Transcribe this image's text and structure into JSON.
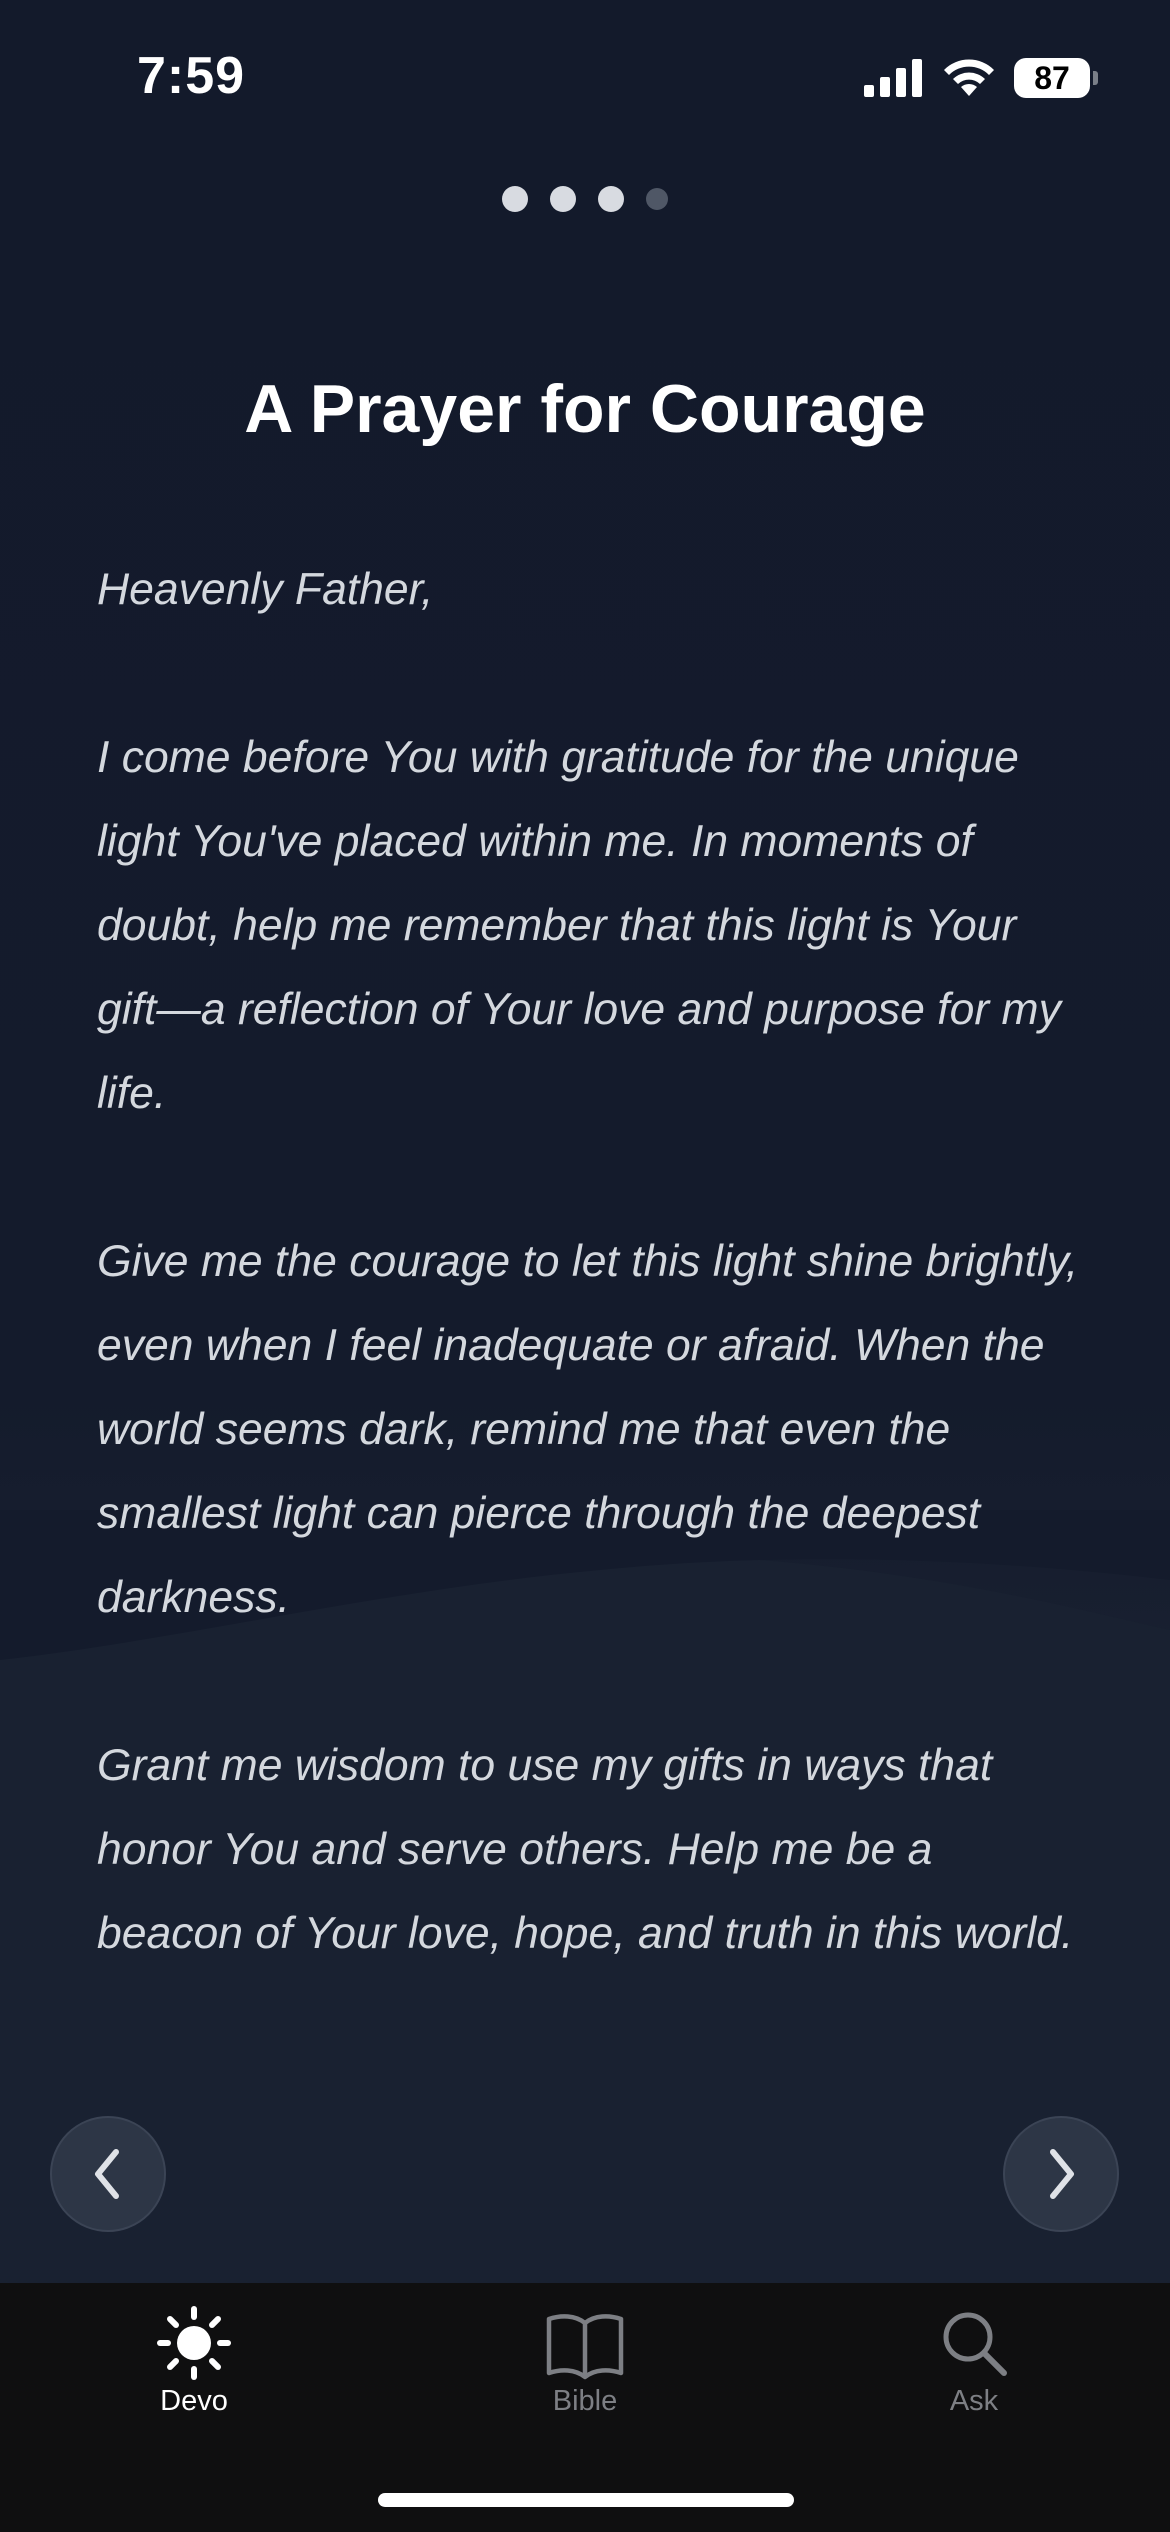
{
  "status_bar": {
    "time": "7:59",
    "battery_level": "87",
    "icons": [
      "cellular-signal-icon",
      "wifi-icon",
      "battery-icon"
    ]
  },
  "page_indicator": {
    "total_pages": 4,
    "current_page": 3
  },
  "devotional": {
    "title": "A Prayer for Courage",
    "paragraphs": [
      "Heavenly Father,",
      "I come before You with gratitude for the unique light You've placed within me. In moments of doubt, help me remember that this light is Your gift—a reflection of Your love and purpose for my life.",
      "Give me the courage to let this light shine brightly, even when I feel inadequate or afraid. When the world seems dark, remind me that even the smallest light can pierce through the deepest darkness.",
      "Grant me wisdom to use my gifts in ways that honor You and serve others. Help me be a beacon of Your love, hope, and truth in this world."
    ]
  },
  "navigation": {
    "prev_icon": "chevron-left-icon",
    "next_icon": "chevron-right-icon"
  },
  "tab_bar": {
    "tabs": [
      {
        "label": "Devo",
        "icon": "sun-icon",
        "active": true
      },
      {
        "label": "Bible",
        "icon": "book-icon",
        "active": false
      },
      {
        "label": "Ask",
        "icon": "search-icon",
        "active": false
      }
    ]
  },
  "colors": {
    "background": "#131a2b",
    "text_primary": "#ffffff",
    "text_body": "#d4d8de",
    "tab_inactive": "#7d7f84"
  }
}
